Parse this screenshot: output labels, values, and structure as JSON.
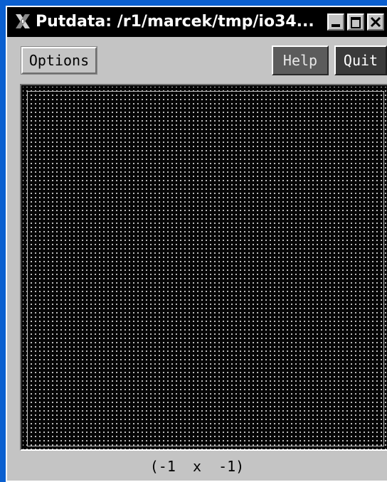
{
  "window": {
    "title": "Putdata: /r1/marcek/tmp/io34...",
    "icon": "x-logo-icon",
    "controls": [
      "minimize-icon",
      "maximize-icon",
      "close-icon"
    ]
  },
  "toolbar": {
    "options_label": "Options",
    "help_label": "Help",
    "quit_label": "Quit"
  },
  "canvas": {
    "background": "#000000",
    "dot_color": "#d8d8d8"
  },
  "status": {
    "coordinates": "(-1  x  -1)"
  },
  "colors": {
    "desktop": "#0a5fd0",
    "chrome": "#c4c4c4",
    "titlebar": "#000000"
  }
}
